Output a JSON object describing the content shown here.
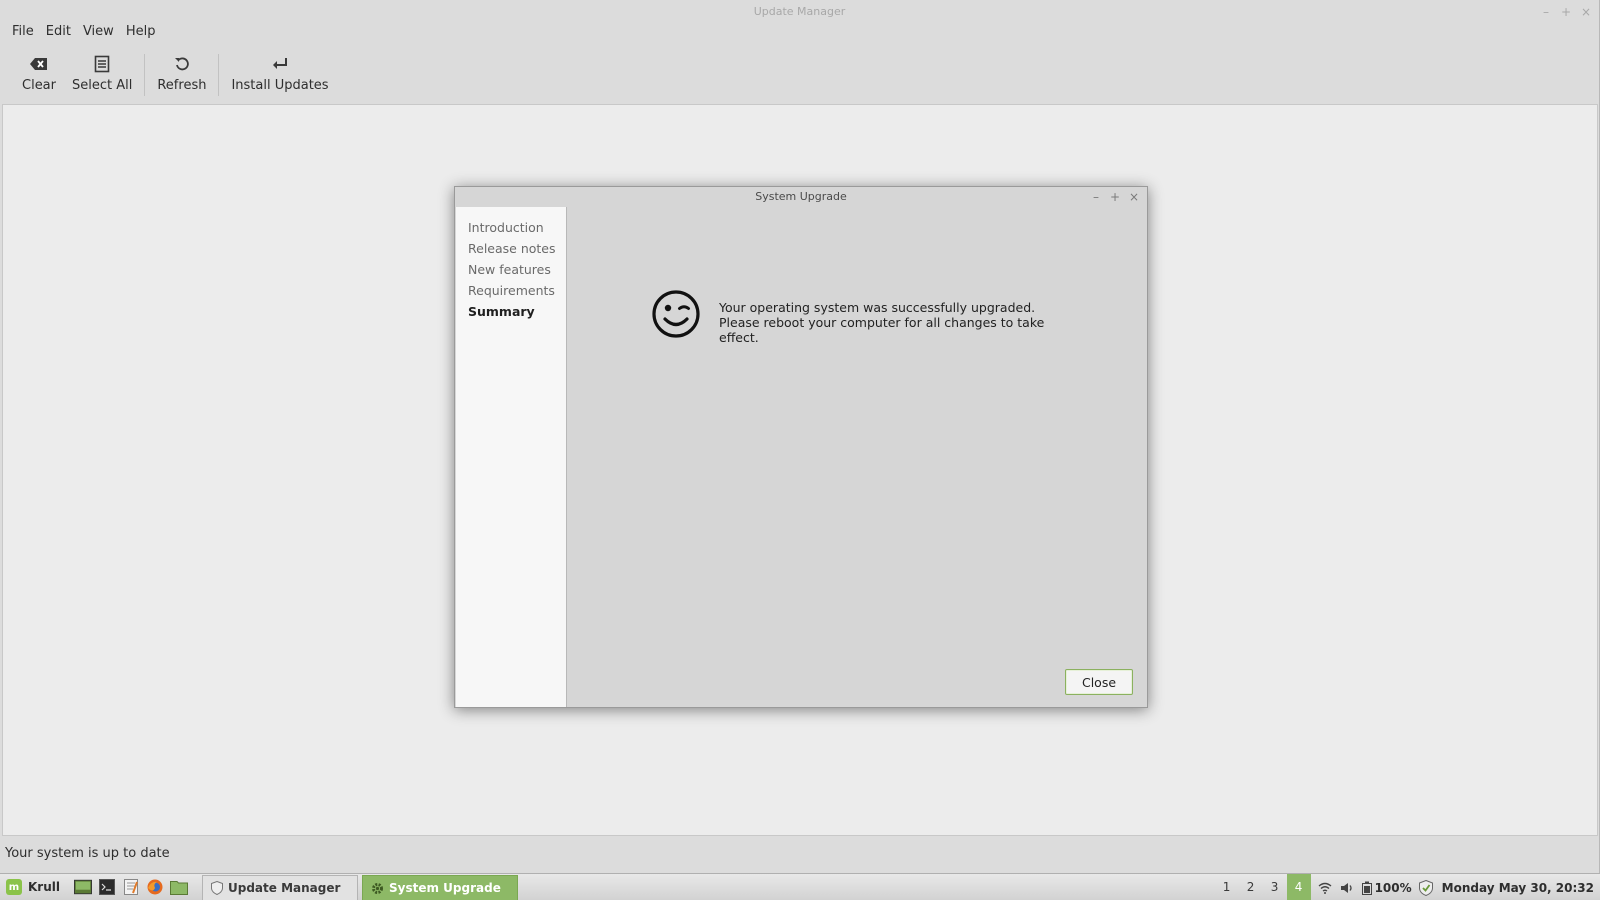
{
  "main_window": {
    "title": "Update Manager",
    "controls": {
      "minimize": "–",
      "maximize": "+",
      "close": "×"
    }
  },
  "menubar": [
    "File",
    "Edit",
    "View",
    "Help"
  ],
  "toolbar": {
    "clear": {
      "label": "Clear",
      "icon": "clear-icon"
    },
    "select_all": {
      "label": "Select All",
      "icon": "select-all-icon"
    },
    "refresh": {
      "label": "Refresh",
      "icon": "refresh-icon"
    },
    "install": {
      "label": "Install Updates",
      "icon": "install-updates-icon"
    }
  },
  "status": {
    "text": "Your system is up to date"
  },
  "dialog": {
    "title": "System Upgrade",
    "controls": {
      "minimize": "–",
      "maximize": "+",
      "close": "×"
    },
    "nav": [
      {
        "label": "Introduction",
        "active": false
      },
      {
        "label": "Release notes",
        "active": false
      },
      {
        "label": "New features",
        "active": false
      },
      {
        "label": "Requirements",
        "active": false
      },
      {
        "label": "Summary",
        "active": true
      }
    ],
    "message": "Your operating system was successfully upgraded. Please reboot your computer for all changes to take effect.",
    "icon": "wink-smiley-icon",
    "close_label": "Close"
  },
  "taskbar": {
    "menu_label": "Krull",
    "tasks": [
      {
        "label": "Update Manager",
        "active": false
      },
      {
        "label": "System Upgrade",
        "active": true
      }
    ],
    "workspaces": [
      "1",
      "2",
      "3",
      "4"
    ],
    "active_workspace": "4",
    "battery": "100%",
    "clock": "Monday May 30, 20:32"
  },
  "colors": {
    "accent": "#8db966",
    "dialog_bg": "#d6d6d6",
    "sidebar_bg": "#f7f7f7"
  }
}
